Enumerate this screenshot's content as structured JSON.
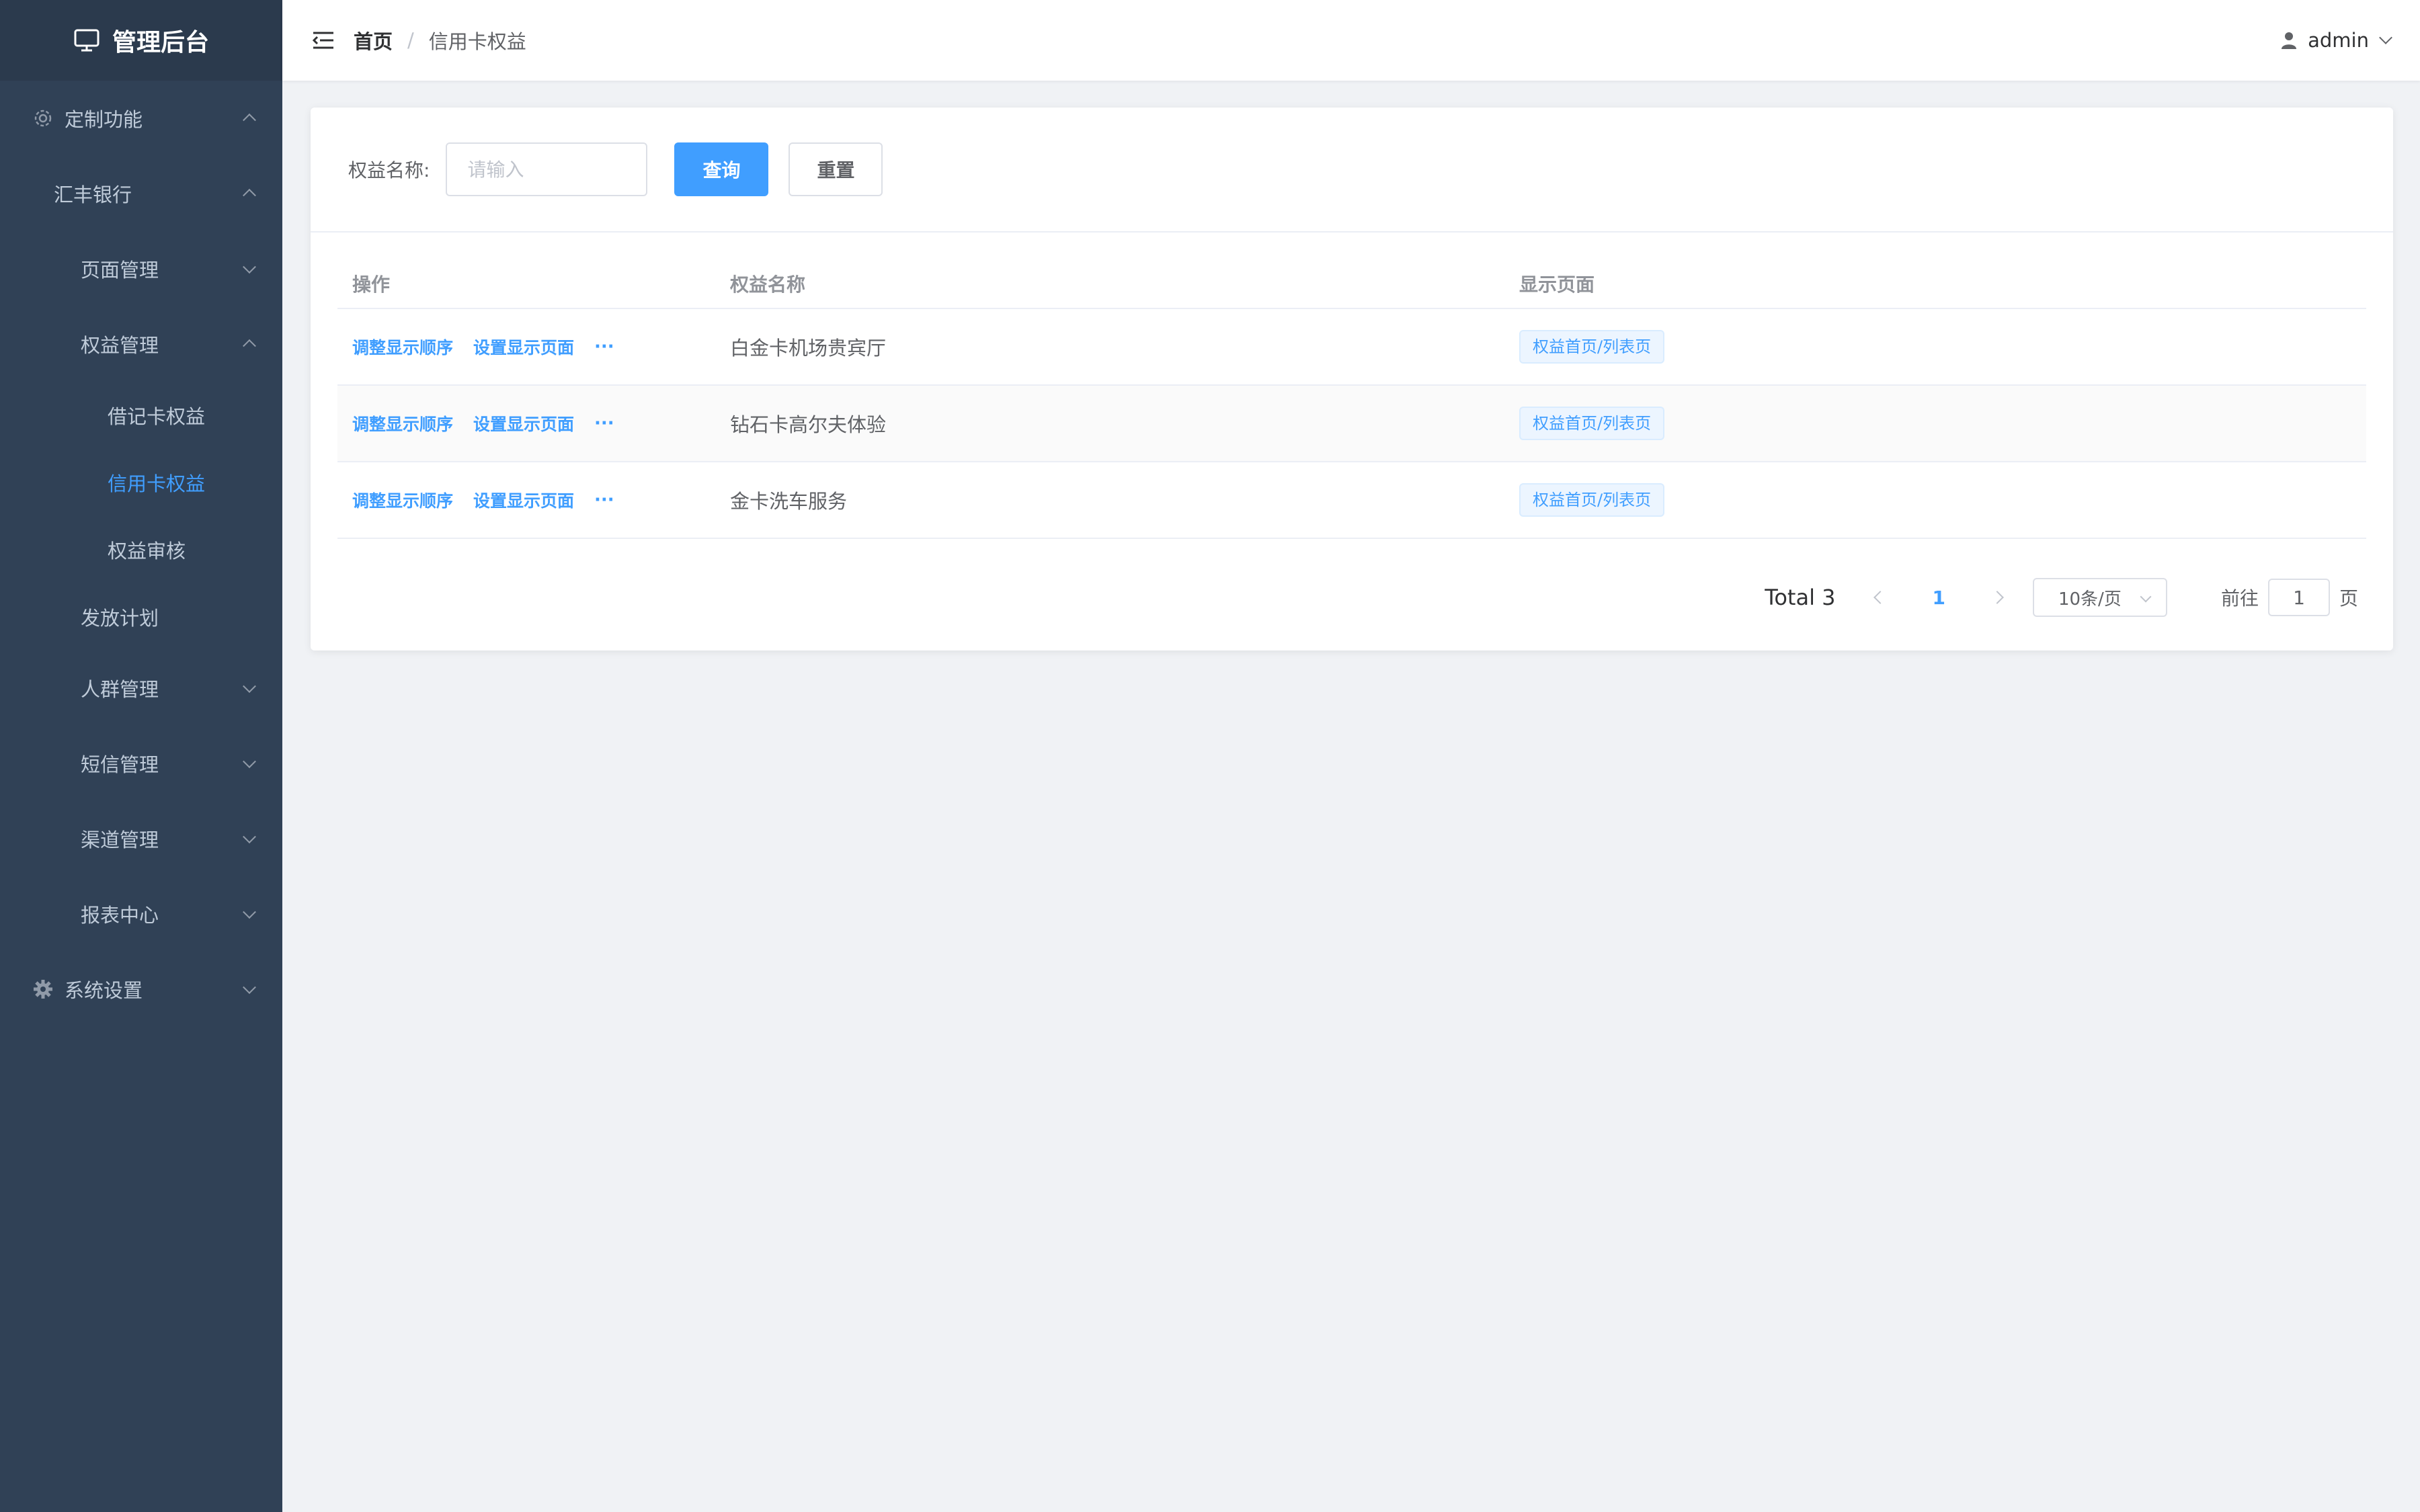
{
  "app": {
    "title": "管理后台"
  },
  "sidebar": {
    "items": [
      {
        "label": "定制功能"
      },
      {
        "label": "汇丰银行"
      },
      {
        "label": "页面管理"
      },
      {
        "label": "权益管理"
      },
      {
        "label": "借记卡权益"
      },
      {
        "label": "信用卡权益"
      },
      {
        "label": "权益审核"
      },
      {
        "label": "发放计划"
      },
      {
        "label": "人群管理"
      },
      {
        "label": "短信管理"
      },
      {
        "label": "渠道管理"
      },
      {
        "label": "报表中心"
      },
      {
        "label": "系统设置"
      }
    ]
  },
  "header": {
    "breadcrumb": {
      "home": "首页",
      "separator": "/",
      "current": "信用卡权益"
    },
    "user": "admin"
  },
  "filter": {
    "label": "权益名称:",
    "placeholder": "请输入",
    "query_label": "查询",
    "reset_label": "重置"
  },
  "table": {
    "columns": [
      "操作",
      "权益名称",
      "显示页面"
    ],
    "ops": {
      "adjust": "调整显示顺序",
      "set_page": "设置显示页面",
      "more": "···"
    },
    "rows": [
      {
        "name": "白金卡机场贵宾厅",
        "page": "权益首页/列表页"
      },
      {
        "name": "钻石卡高尔夫体验",
        "page": "权益首页/列表页"
      },
      {
        "name": "金卡洗车服务",
        "page": "权益首页/列表页"
      }
    ]
  },
  "pagination": {
    "total": "Total 3",
    "current": "1",
    "page_size": "10条/页",
    "goto_label": "前往",
    "goto_value": "1",
    "page_suffix": "页"
  },
  "colors": {
    "sidebar_bg": "#304156",
    "accent": "#409eff",
    "page_bg": "#f0f2f5"
  }
}
